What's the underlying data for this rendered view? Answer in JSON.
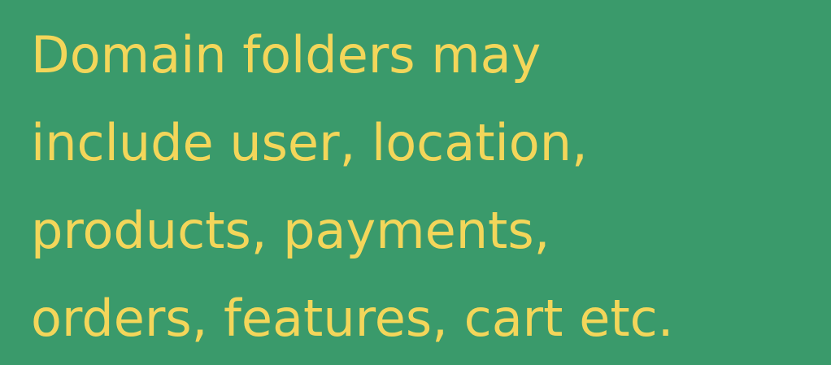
{
  "slide": {
    "lines": [
      "Domain folders may",
      "include user, location,",
      "products, payments,",
      "orders, features, cart etc."
    ],
    "background_color": "#3a9a6b",
    "text_color": "#f3d65a"
  }
}
